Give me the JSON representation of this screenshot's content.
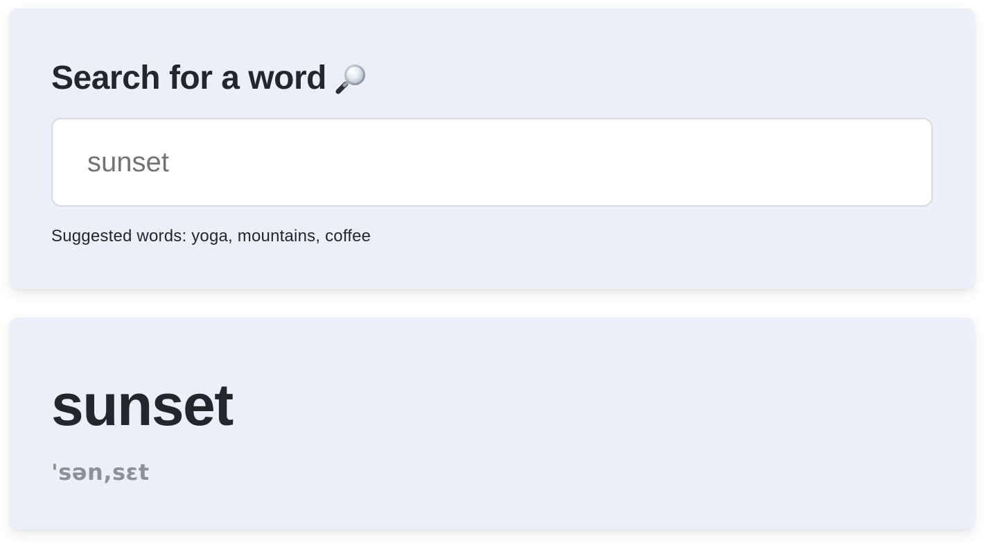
{
  "search": {
    "title": "Search for a word",
    "title_icon": "magnifying-glass-icon",
    "input_value": "sunset",
    "input_placeholder": "sunset",
    "suggestions_label": "Suggested words:",
    "suggested_words": [
      "yoga",
      "mountains",
      "coffee"
    ]
  },
  "result": {
    "word": "sunset",
    "phonetic": "'sən,sɛt"
  },
  "colors": {
    "card_background": "#ebeff8",
    "text_primary": "#23272b",
    "text_muted": "#8d9196",
    "input_border": "#d6dadf"
  }
}
